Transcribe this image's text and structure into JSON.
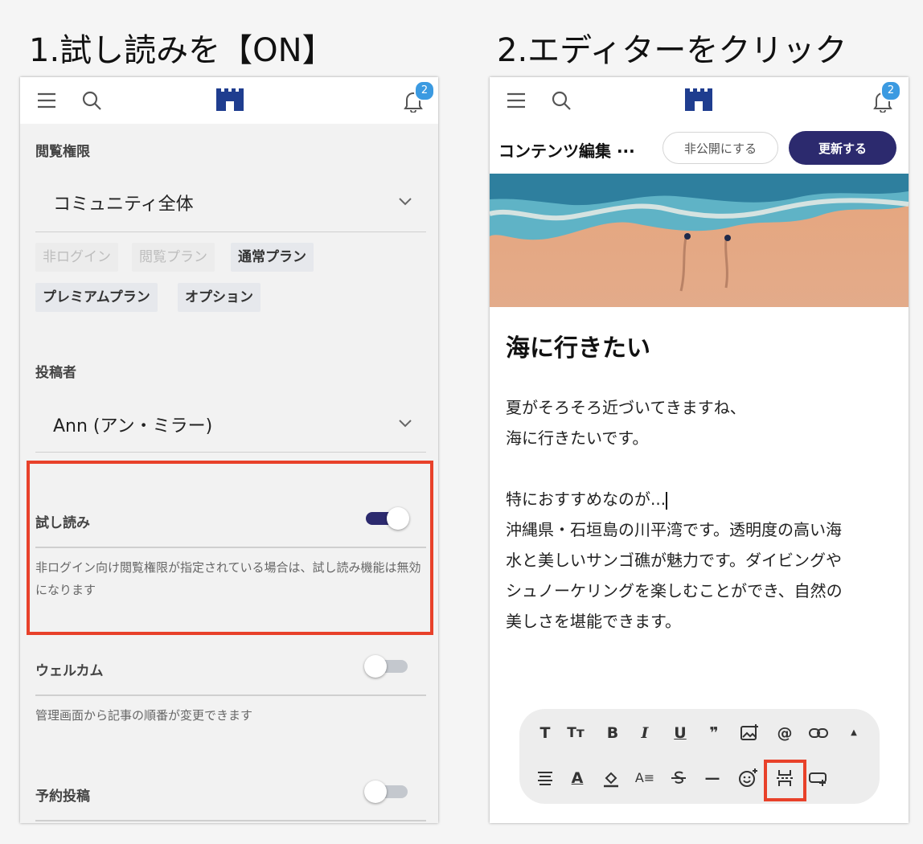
{
  "steps": {
    "step1": "1.試し読みを【ON】",
    "step2": "2.エディターをクリック"
  },
  "appbar": {
    "notification_count": "2"
  },
  "settings": {
    "visibility_label": "閲覧権限",
    "visibility_value": "コミュニティ全体",
    "plans": [
      {
        "label": "非ログイン",
        "active": false
      },
      {
        "label": "閲覧プラン",
        "active": false
      },
      {
        "label": "通常プラン",
        "active": true
      },
      {
        "label": "プレミアムプラン",
        "active": true
      },
      {
        "label": "オプション",
        "active": true
      }
    ],
    "author_label": "投稿者",
    "author_value": "Ann (アン・ミラー)",
    "preview": {
      "label": "試し読み",
      "enabled": true,
      "help": "非ログイン向け閲覧権限が指定されている場合は、試し読み機能は無効になります"
    },
    "welcome": {
      "label": "ウェルカム",
      "enabled": false,
      "help": "管理画面から記事の順番が変更できます"
    },
    "scheduled": {
      "label": "予約投稿",
      "enabled": false
    }
  },
  "editor": {
    "header_title": "コンテンツ編集 ···",
    "unpublish_label": "非公開にする",
    "update_label": "更新する",
    "post_title": "海に行きたい",
    "paragraphs": [
      "夏がそろそろ近づいてきますね、",
      "海に行きたいです。",
      "",
      "特におすすめなのが...",
      "沖縄県・石垣島の川平湾です。透明度の高い海",
      "水と美しいサンゴ礁が魅力です。ダイビングや",
      "シュノーケリングを楽しむことができ、自然の",
      "美しさを堪能できます。"
    ],
    "toolbar_row1": [
      "T",
      "Tт",
      "B",
      "I",
      "U",
      "❞",
      "image-add-icon",
      "@",
      "link-icon",
      "▲"
    ],
    "toolbar_row2": [
      "align-icon",
      "A",
      "paint-bucket-icon",
      "A≡",
      "strike-icon",
      "—",
      "emoji-add-icon",
      "preview-divider-icon",
      "button-add-icon"
    ]
  },
  "colors": {
    "accent": "#2c2a6e",
    "highlight": "#e8412a",
    "badge": "#3b9ae1"
  }
}
